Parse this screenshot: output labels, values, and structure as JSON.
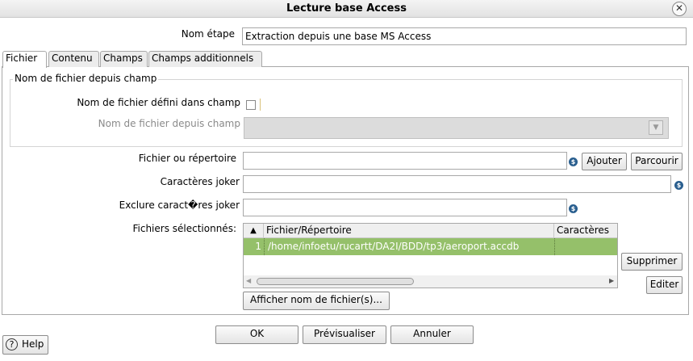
{
  "window": {
    "title": "Lecture base Access",
    "close_glyph": "✕"
  },
  "step": {
    "label": "Nom étape",
    "value": "Extraction depuis une base MS Access"
  },
  "tabs": [
    {
      "label": "Fichier"
    },
    {
      "label": "Contenu"
    },
    {
      "label": "Champs"
    },
    {
      "label": "Champs additionnels"
    }
  ],
  "group": {
    "legend": "Nom de fichier depuis champ",
    "checkbox_label": "Nom de fichier défini dans champ",
    "field_label": "Nom de fichier depuis champ",
    "field_value": ""
  },
  "file": {
    "label": "Fichier ou répertoire",
    "value": "",
    "add_button": "Ajouter",
    "browse_button": "Parcourir"
  },
  "wildcard": {
    "label": "Caractères joker",
    "value": ""
  },
  "exclude": {
    "label": "Exclure caract�res joker",
    "value": ""
  },
  "selected_files": {
    "label": "Fichiers sélectionnés:",
    "columns": [
      "▲",
      "Fichier/Répertoire",
      "Caractères"
    ],
    "rows": [
      {
        "index": "1",
        "path": "/home/infoetu/rucartt/DA2I/BDD/tp3/aeroport.accdb",
        "wildcard": ""
      }
    ],
    "delete_button": "Supprimer",
    "edit_button": "Editer",
    "show_button": "Afficher nom de fichier(s)..."
  },
  "footer": {
    "ok": "OK",
    "preview": "Prévisualiser",
    "cancel": "Annuler",
    "help": "Help"
  },
  "icons": {
    "variable": "variable-icon",
    "dropdown": "chevron-down-icon",
    "help": "help-icon",
    "close": "close-icon"
  },
  "colors": {
    "selected_row": "#95c06a",
    "variable_icon": "#2a5f8f"
  }
}
